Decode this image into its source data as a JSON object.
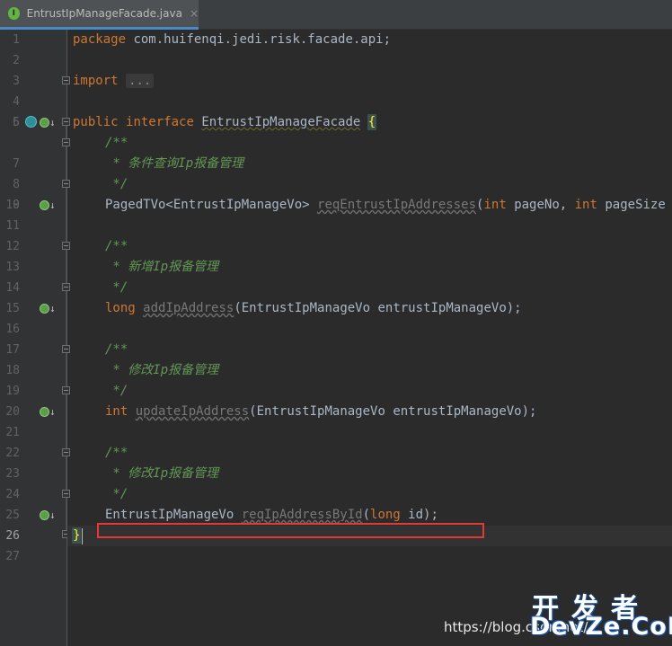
{
  "tab": {
    "icon_letter": "I",
    "filename": "EntrustIpManageFacade.java",
    "close_glyph": "×"
  },
  "line_numbers": [
    "1",
    "2",
    "3",
    "4",
    "5",
    "6",
    "7",
    "8",
    "9",
    "10",
    "11",
    "12",
    "13",
    "14",
    "15",
    "16",
    "17",
    "18",
    "19",
    "20",
    "21",
    "22",
    "23",
    "24",
    "25",
    "26",
    "27"
  ],
  "code": {
    "l1_kw": "package",
    "l1_rest": " com.huifenqi.jedi.risk.facade.api;",
    "l3_kw": "import",
    "l3_fold": "...",
    "l6_kw1": "public",
    "l6_kw2": "interface",
    "l6_name": "EntrustIpManageFacade",
    "l6_brace": "{",
    "l7": "/**",
    "l8": " * 条件查询Ip报备管理",
    "l9": " */",
    "l10_type": "PagedTVo<EntrustIpManageVo> ",
    "l10_method": "reqEntrustIpAddresses",
    "l10_p1_open": "(",
    "l10_kw1": "int",
    "l10_p1": " pageNo, ",
    "l10_kw2": "int",
    "l10_p2": " pageSize",
    "l12": "/**",
    "l13": " * 新增Ip报备管理",
    "l14": " */",
    "l15_kw": "long",
    "l15_method": "addIpAddress",
    "l15_rest": "(EntrustIpManageVo entrustIpManageVo);",
    "l17": "/**",
    "l18": " * 修改Ip报备管理",
    "l19": " */",
    "l20_kw": "int",
    "l20_method": "updateIpAddress",
    "l20_rest": "(EntrustIpManageVo entrustIpManageVo);",
    "l22": "/**",
    "l23": " * 修改Ip报备管理",
    "l24": " */",
    "l25_type": "EntrustIpManageVo ",
    "l25_method": "reqIpAddressById",
    "l25_open": "(",
    "l25_kw": "long",
    "l25_rest": " id);",
    "l26_brace": "}"
  },
  "watermark": {
    "url": "https://blog.csdn.net/...",
    "logo_top": "开发者",
    "logo_bottom": "DevZe.CoM"
  },
  "colors": {
    "background": "#2b2b2b",
    "keyword": "#cc7832",
    "comment": "#629755",
    "highlight_box": "#e53935"
  }
}
